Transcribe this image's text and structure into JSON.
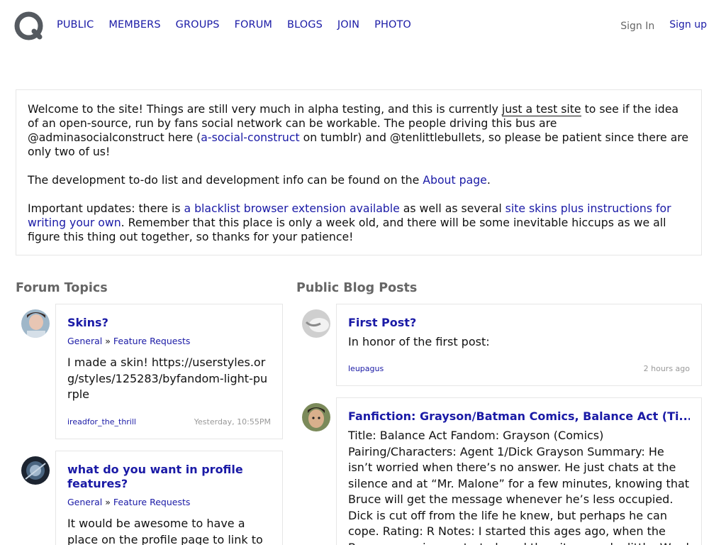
{
  "nav": {
    "items": [
      "PUBLIC",
      "MEMBERS",
      "GROUPS",
      "FORUM",
      "BLOGS",
      "JOIN",
      "PHOTO"
    ],
    "sign_in": "Sign In",
    "sign_up": "Sign up"
  },
  "welcome": {
    "p1_a": "Welcome to the site! Things are still very much in alpha testing, and this is currently ",
    "p1_link": "just a test site",
    "p1_b": " to see if the idea of an open-source, run by fans social network can be workable. The people driving this bus are @adminasocialconstruct here (",
    "p1_link2": "a-social-construct",
    "p1_c": " on tumblr) and @tenlittlebullets, so please be patient since there are only two of us!",
    "p2_a": "The development to-do list and development info can be found on the ",
    "p2_link": "About page",
    "p2_b": ".",
    "p3_a": "Important updates: there is ",
    "p3_link1": "a blacklist browser extension available",
    "p3_b": " as well as several ",
    "p3_link2": "site skins plus instructions for writing your own",
    "p3_c": ". Remember that this place is only a week old, and there will be some inevitable hiccups as we all figure this thing out together, so thanks for your patience!"
  },
  "forum": {
    "title": "Forum Topics",
    "topics": [
      {
        "title": "Skins?",
        "crumb1": "General",
        "sep": "»",
        "crumb2": "Feature Requests",
        "body": "I made a skin! https://userstyles.org/styles/125283/byfandom-light-purple",
        "author": "ireadfor_the_thrill",
        "time": "Yesterday, 10:55PM"
      },
      {
        "title": "what do you want in profile features?",
        "crumb1": "General",
        "sep": "»",
        "crumb2": "Feature Requests",
        "body": "It would be awesome to have a place on the profile page to link to a"
      }
    ]
  },
  "blogs": {
    "title": "Public Blog Posts",
    "posts": [
      {
        "title": "First Post?",
        "body": "In honor of the first post:",
        "author": "leupagus",
        "time": "2 hours ago"
      },
      {
        "title": "Fanfiction: Grayson/Batman Comics, Balance Act (Ti...",
        "body": "Title: Balance Act Fandom: Grayson (Comics) Pairing/Characters: Agent 1/Dick Grayson Summary: He isn’t worried when there’s no answer. He just chats at the silence and at “Mr. Malone” for a few minutes, knowing that Bruce will get the message whenever he’s less occupied. Dick is cut off from the life he knew, but perhaps he can cope. Rating: R Notes: I started this ages ago, when the Bruce amnesia arc started, and then it warped a little. Word Count:"
      }
    ]
  },
  "colors": {
    "link": "#1a1aa6",
    "muted": "#666666",
    "border": "#e6e6e6"
  }
}
